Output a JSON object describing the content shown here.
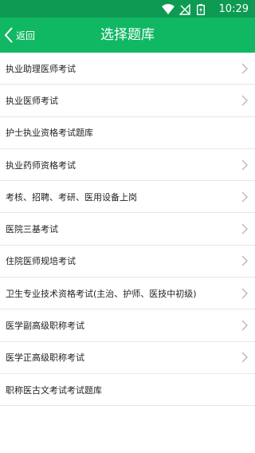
{
  "status_bar": {
    "time": "10:29",
    "icons": [
      "wifi-icon",
      "signal-icon",
      "battery-icon"
    ]
  },
  "header": {
    "back_label": "返回",
    "title": "选择题库",
    "color": "#11b863"
  },
  "items": [
    {
      "label": "执业助理医师考试",
      "has_chevron": true
    },
    {
      "label": "执业医师考试",
      "has_chevron": true
    },
    {
      "label": "护士执业资格考试题库",
      "has_chevron": false
    },
    {
      "label": "执业药师资格考试",
      "has_chevron": true
    },
    {
      "label": "考核、招聘、考研、医用设备上岗",
      "has_chevron": true
    },
    {
      "label": "医院三基考试",
      "has_chevron": true
    },
    {
      "label": "住院医师规培考试",
      "has_chevron": true
    },
    {
      "label": "卫生专业技术资格考试(主治、护师、医技中初级)",
      "has_chevron": true
    },
    {
      "label": "医学副高级职称考试",
      "has_chevron": true
    },
    {
      "label": "医学正高级职称考试",
      "has_chevron": true
    },
    {
      "label": "职称医古文考试考试题库",
      "has_chevron": false
    }
  ]
}
